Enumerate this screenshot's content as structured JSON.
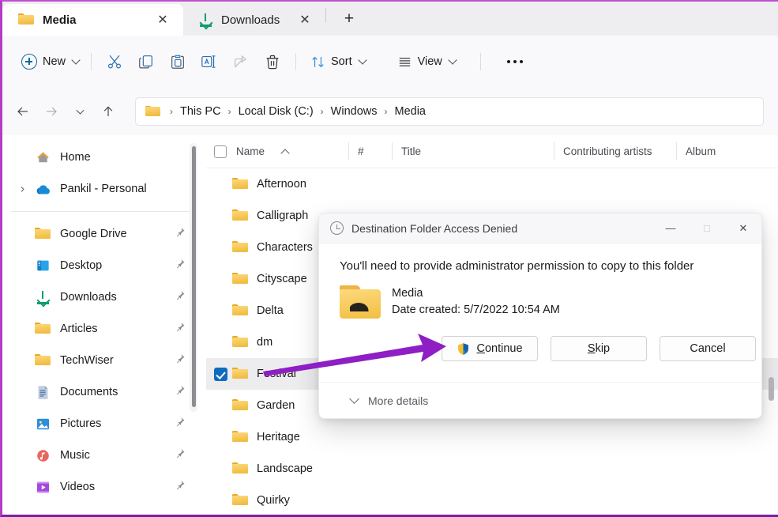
{
  "window": {
    "accent_border": "#b53bc4",
    "tabs": [
      {
        "label": "Media",
        "icon": "folder-icon",
        "active": true,
        "close": "✕"
      },
      {
        "label": "Downloads",
        "icon": "download-icon",
        "active": false,
        "close": "✕"
      }
    ],
    "new_tab_label": "+"
  },
  "toolbar": {
    "new_label": "New",
    "sort_label": "Sort",
    "view_label": "View",
    "overflow_label": "See more",
    "items": [
      {
        "name": "new-button",
        "label": "New"
      },
      {
        "name": "cut-button",
        "label": "Cut"
      },
      {
        "name": "copy-button",
        "label": "Copy"
      },
      {
        "name": "paste-button",
        "label": "Paste"
      },
      {
        "name": "rename-button",
        "label": "Rename"
      },
      {
        "name": "share-button",
        "label": "Share"
      },
      {
        "name": "delete-button",
        "label": "Delete"
      },
      {
        "name": "sort-button",
        "label": "Sort"
      },
      {
        "name": "view-button",
        "label": "View"
      },
      {
        "name": "more-button",
        "label": "..."
      }
    ]
  },
  "addressbar": {
    "back_label": "Back",
    "forward_label": "Forward",
    "recent_label": "Recent locations",
    "up_label": "Up to Windows",
    "breadcrumbs": [
      "This PC",
      "Local Disk (C:)",
      "Windows",
      "Media"
    ],
    "separator": "›"
  },
  "sidebar": {
    "items": [
      {
        "label": "Home",
        "icon": "home-icon",
        "pinned": false,
        "expander": false
      },
      {
        "label": "Pankil - Personal",
        "icon": "onedrive-cloud-icon",
        "pinned": false,
        "expander": true
      },
      {
        "divider": true
      },
      {
        "label": "Google Drive",
        "icon": "folder-icon",
        "pinned": true,
        "expander": false
      },
      {
        "label": "Desktop",
        "icon": "desktop-icon",
        "pinned": true,
        "expander": false
      },
      {
        "label": "Downloads",
        "icon": "download-icon",
        "pinned": true,
        "expander": false
      },
      {
        "label": "Articles",
        "icon": "folder-icon",
        "pinned": true,
        "expander": false
      },
      {
        "label": "TechWiser",
        "icon": "folder-icon",
        "pinned": true,
        "expander": false
      },
      {
        "label": "Documents",
        "icon": "documents-icon",
        "pinned": true,
        "expander": false
      },
      {
        "label": "Pictures",
        "icon": "pictures-icon",
        "pinned": true,
        "expander": false
      },
      {
        "label": "Music",
        "icon": "music-icon",
        "pinned": true,
        "expander": false
      },
      {
        "label": "Videos",
        "icon": "videos-icon",
        "pinned": true,
        "expander": false
      }
    ]
  },
  "filelist": {
    "columns": [
      {
        "label": "Name",
        "sorted": true,
        "sort_dir": "asc"
      },
      {
        "label": "#"
      },
      {
        "label": "Title"
      },
      {
        "label": "Contributing artists"
      },
      {
        "label": "Album"
      }
    ],
    "rows": [
      {
        "name": "Afternoon",
        "selected": false
      },
      {
        "name": "Calligraph",
        "selected": false
      },
      {
        "name": "Characters",
        "selected": false
      },
      {
        "name": "Cityscape",
        "selected": false
      },
      {
        "name": "Delta",
        "selected": false
      },
      {
        "name": "dm",
        "selected": false
      },
      {
        "name": "Festival",
        "selected": true
      },
      {
        "name": "Garden",
        "selected": false
      },
      {
        "name": "Heritage",
        "selected": false
      },
      {
        "name": "Landscape",
        "selected": false
      },
      {
        "name": "Quirky",
        "selected": false
      }
    ]
  },
  "dialog": {
    "title": "Destination Folder Access Denied",
    "minimize_label": "—",
    "maximize_label": "□",
    "close_label": "✕",
    "message": "You'll need to provide administrator permission to copy to this folder",
    "file_name": "Media",
    "file_date": "Date created: 5/7/2022 10:54 AM",
    "buttons": [
      {
        "label": "Continue",
        "accel": "C",
        "shield": true
      },
      {
        "label": "Skip",
        "accel": "S",
        "shield": false
      },
      {
        "label": "Cancel",
        "accel": "",
        "shield": false
      }
    ],
    "more_details_label": "More details"
  },
  "annotation": {
    "arrow_color": "#8e1fc4"
  }
}
